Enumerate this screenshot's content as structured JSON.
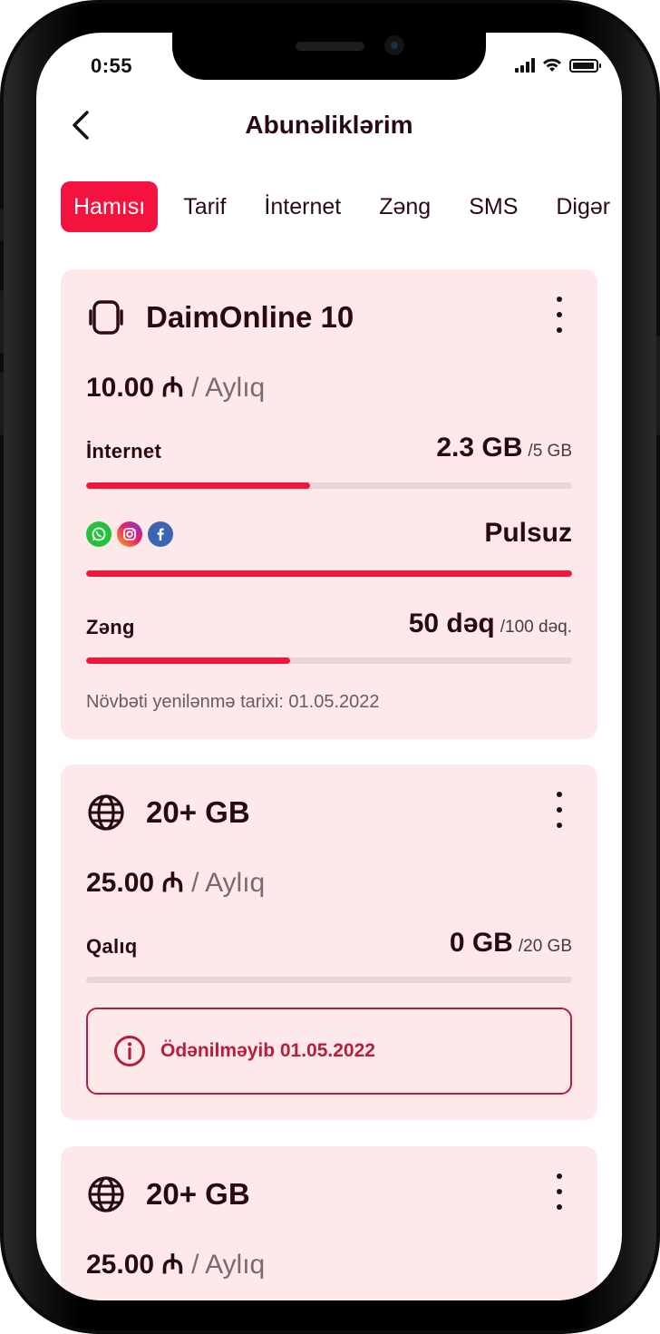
{
  "status_bar": {
    "time": "0:55"
  },
  "header": {
    "title": "Abunəliklərim"
  },
  "tabs": [
    {
      "label": "Hamısı",
      "active": true
    },
    {
      "label": "Tarif"
    },
    {
      "label": "İnternet"
    },
    {
      "label": "Zəng"
    },
    {
      "label": "SMS"
    },
    {
      "label": "Digər"
    }
  ],
  "cards": [
    {
      "icon": "phone-icon",
      "title": "DaimOnline 10",
      "price": "10.00 ₼",
      "period": "/ Aylıq",
      "internet": {
        "label": "İnternet",
        "value": "2.3 GB",
        "total": "/5 GB",
        "progress": 0.46
      },
      "social": {
        "icons": [
          "whatsapp-icon",
          "instagram-icon",
          "facebook-icon"
        ],
        "value": "Pulsuz",
        "progress": 1.0
      },
      "call": {
        "label": "Zəng",
        "value": "50 dəq",
        "total": "/100 dəq.",
        "progress": 0.42
      },
      "renewal": "Növbəti yenilənmə tarixi: 01.05.2022"
    },
    {
      "icon": "globe-icon",
      "title": "20+ GB",
      "price": "25.00 ₼",
      "period": "/ Aylıq",
      "remaining": {
        "label": "Qalıq",
        "value": "0 GB",
        "total": "/20 GB",
        "progress": 0
      },
      "alert": "Ödənilməyib 01.05.2022"
    },
    {
      "icon": "globe-icon",
      "title": "20+ GB",
      "price": "25.00 ₼",
      "period": "/ Aylıq"
    }
  ],
  "colors": {
    "accent": "#f4123f",
    "card_bg": "#fde8ea",
    "text": "#2a0a12",
    "alert": "#b61f3c"
  }
}
